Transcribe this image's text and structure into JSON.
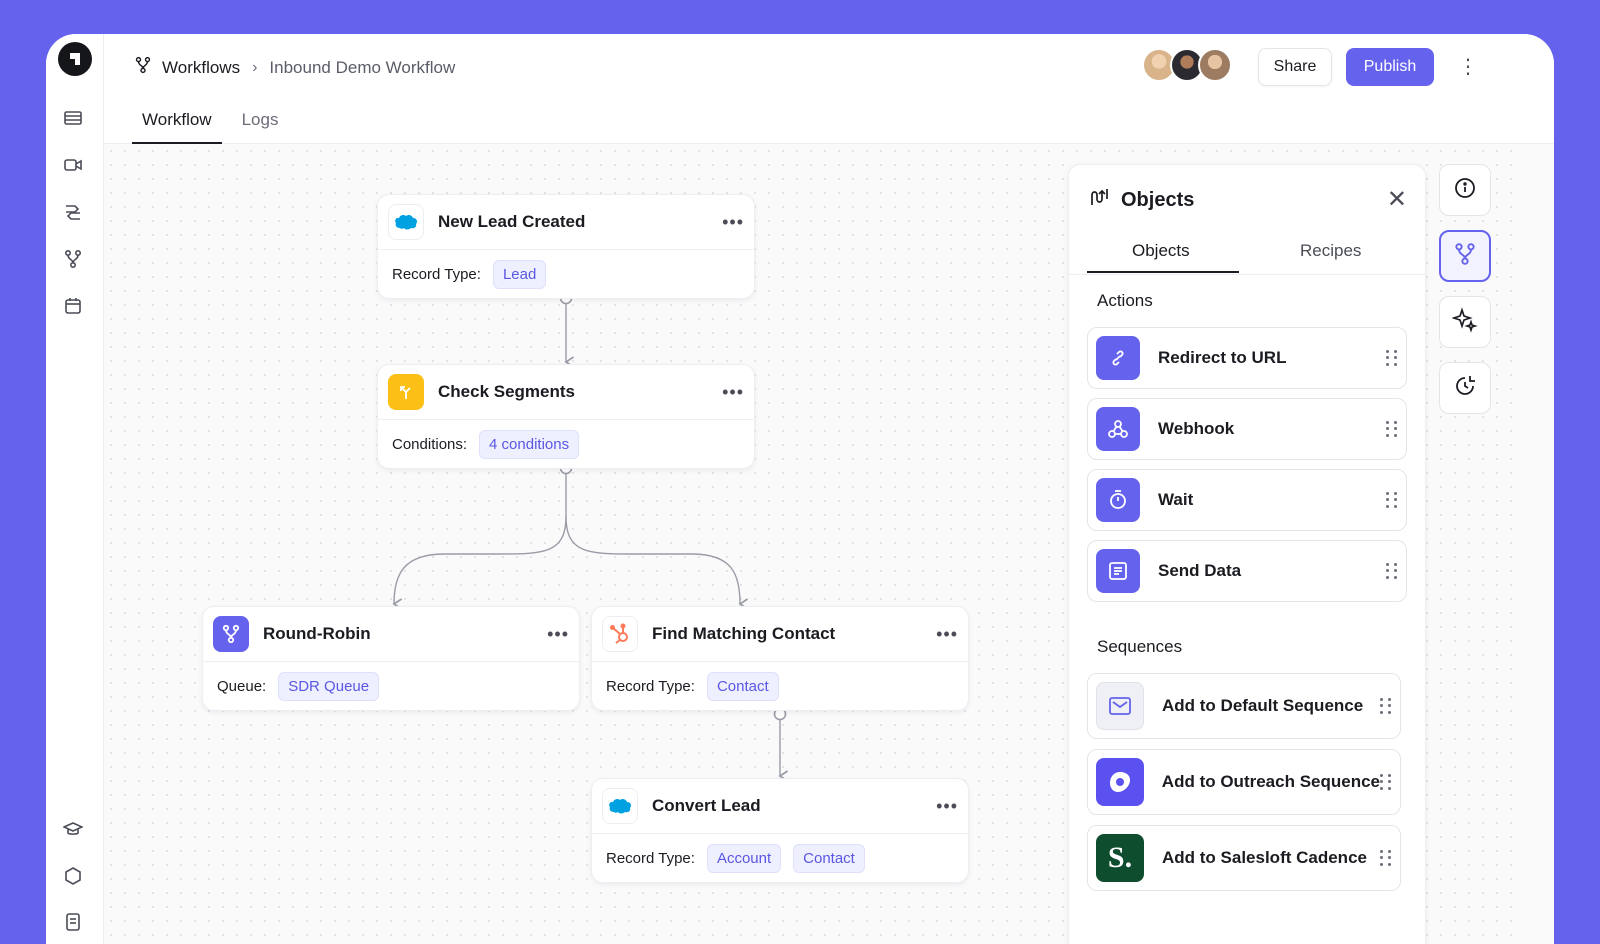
{
  "breadcrumb": {
    "root": "Workflows",
    "separator": "›",
    "page": "Inbound Demo Workflow"
  },
  "tabs": [
    {
      "label": "Workflow"
    },
    {
      "label": "Logs"
    }
  ],
  "header": {
    "share_label": "Share",
    "publish_label": "Publish",
    "more_label": "⋮"
  },
  "colors": {
    "accent": "#6562ee",
    "salesforce": "#00a1e0",
    "segments": "#fbbf16",
    "hubspot": "#ff7a59",
    "salesloft": "#0f4d2f"
  },
  "nodes": {
    "new_lead": {
      "title": "New Lead Created",
      "field_label": "Record Type:",
      "chips": [
        "Lead"
      ],
      "icon": "salesforce-icon"
    },
    "check_segments": {
      "title": "Check Segments",
      "field_label": "Conditions:",
      "chips": [
        "4 conditions"
      ],
      "icon": "branch-icon"
    },
    "round_robin": {
      "title": "Round-Robin",
      "field_label": "Queue:",
      "chips": [
        "SDR Queue"
      ],
      "icon": "round-robin-icon"
    },
    "find_contact": {
      "title": "Find Matching Contact",
      "field_label": "Record Type:",
      "chips": [
        "Contact"
      ],
      "icon": "hubspot-icon"
    },
    "convert_lead": {
      "title": "Convert Lead",
      "field_label": "Record Type:",
      "chips": [
        "Account",
        "Contact"
      ],
      "icon": "salesforce-icon"
    }
  },
  "node_more_label": "•••",
  "panel": {
    "title": "Objects",
    "close_label": "✕",
    "tabs": [
      {
        "label": "Objects"
      },
      {
        "label": "Recipes"
      }
    ],
    "actions_label": "Actions",
    "actions": [
      {
        "label": "Redirect to URL",
        "icon": "link-icon"
      },
      {
        "label": "Webhook",
        "icon": "webhook-icon"
      },
      {
        "label": "Wait",
        "icon": "timer-icon"
      },
      {
        "label": "Send Data",
        "icon": "list-icon"
      }
    ],
    "sequences_label": "Sequences",
    "sequences": [
      {
        "label": "Add to Default Sequence",
        "icon": "mail-icon"
      },
      {
        "label": "Add to Outreach Sequence",
        "icon": "outreach-icon"
      },
      {
        "label": "Add to Salesloft Cadence",
        "icon": "salesloft-icon"
      }
    ]
  },
  "salesloft_letter": "S."
}
